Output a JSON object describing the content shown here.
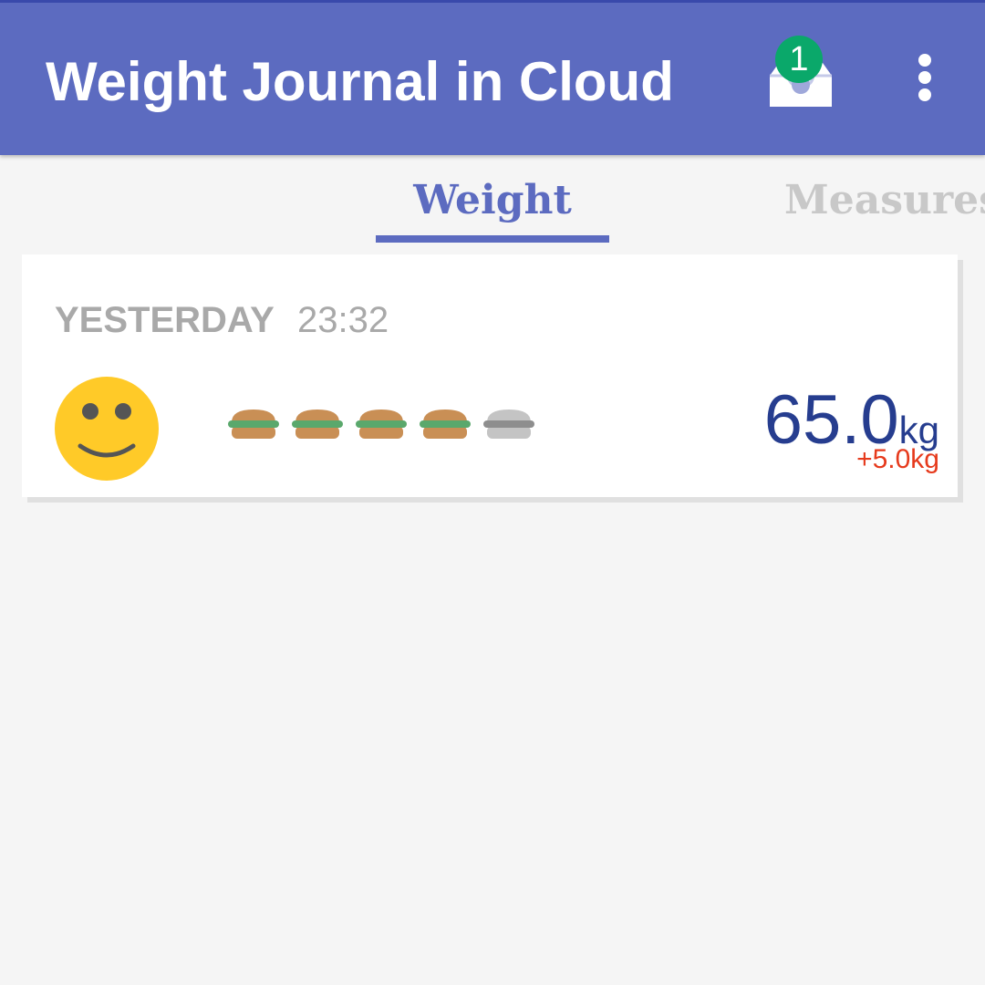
{
  "app_bar": {
    "title": "Weight Journal in Cloud",
    "inbox_badge_count": "1",
    "inbox_icon": "inbox-icon",
    "overflow_icon": "more-vert-icon"
  },
  "tabs": [
    {
      "label": "Weight",
      "selected": true
    },
    {
      "label": "Measures",
      "selected": false
    }
  ],
  "entries": [
    {
      "day": "YESTERDAY",
      "time": "23:32",
      "mood_icon": "smiley-face-icon",
      "food_rating": {
        "filled": 4,
        "total": 5
      },
      "weight": "65.0",
      "weight_unit": "kg",
      "change": "+5.0kg"
    }
  ],
  "colors": {
    "primary": "#5c6bc0",
    "badge": "#0aa86a",
    "weight_text": "#263d8f",
    "change_text": "#e63a1c",
    "mood": "#ffca28"
  }
}
